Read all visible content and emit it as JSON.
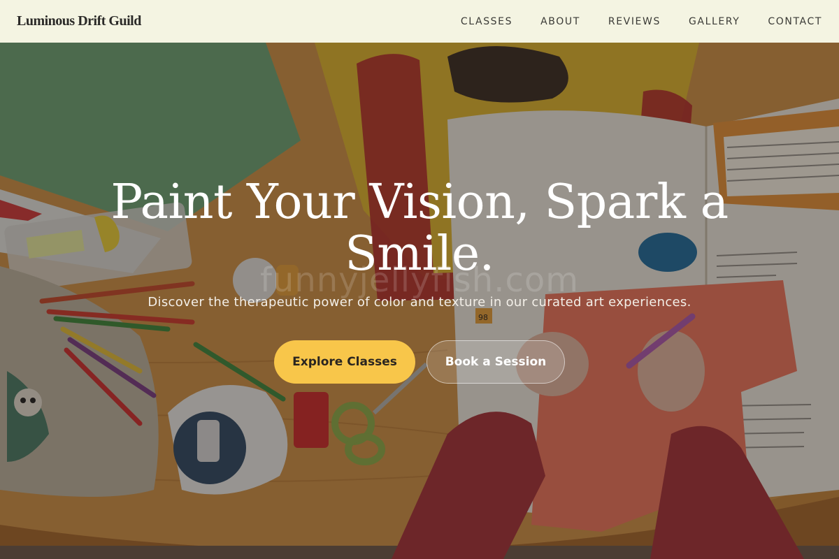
{
  "brand": {
    "name": "Luminous Drift Guild"
  },
  "nav": {
    "items": [
      {
        "label": "CLASSES"
      },
      {
        "label": "ABOUT"
      },
      {
        "label": "REVIEWS"
      },
      {
        "label": "GALLERY"
      },
      {
        "label": "CONTACT"
      }
    ]
  },
  "hero": {
    "headline_line1": "Paint Your Vision, Spark a",
    "headline_line2": "Smile.",
    "subheadline": "Discover the therapeutic power of color and texture in our curated art experiences.",
    "primary_button": "Explore Classes",
    "secondary_button": "Book a Session",
    "watermark": "funnyjellyfish.com",
    "book_page_number": "98"
  },
  "colors": {
    "header_bg": "#f4f4e2",
    "primary_button": "#f8c64a",
    "table_wood": "#c98a3e",
    "yellow_paper": "#e2b830",
    "green_paper": "#6fa878",
    "red_sleeve": "#a8333a"
  }
}
